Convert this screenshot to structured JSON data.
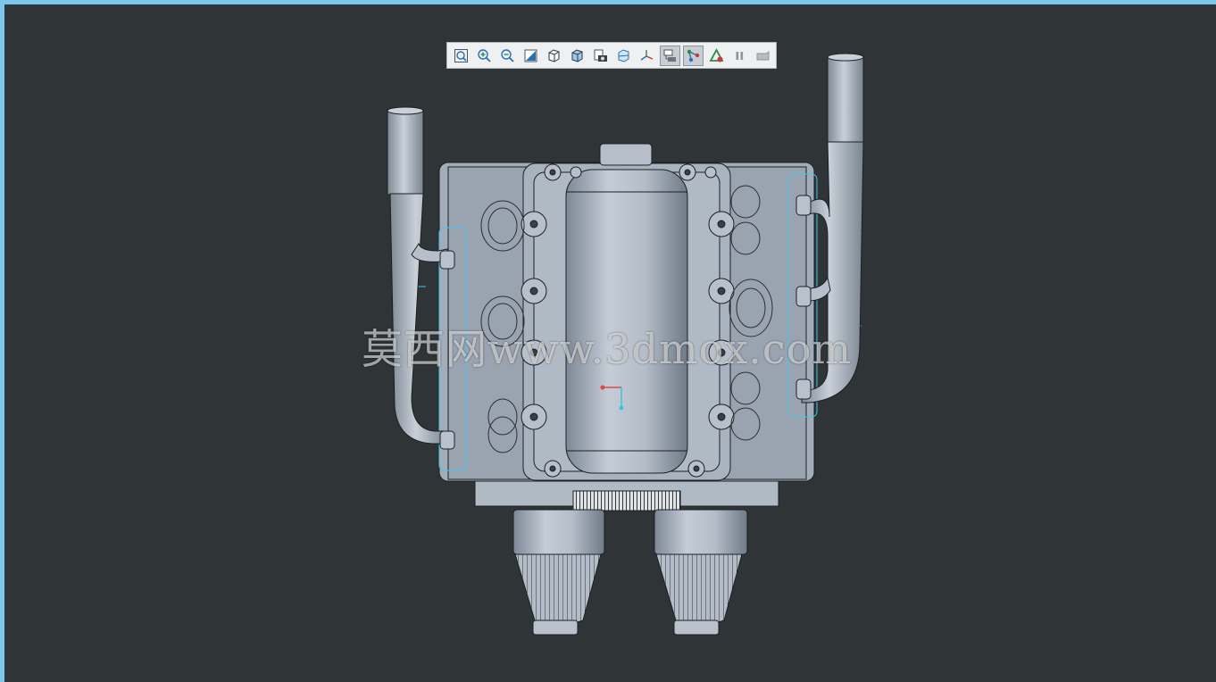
{
  "toolbar": {
    "buttons": [
      {
        "icon": "zoom-fit-icon",
        "active": false
      },
      {
        "icon": "zoom-in-icon",
        "active": false
      },
      {
        "icon": "zoom-out-icon",
        "active": false
      },
      {
        "icon": "zoom-window-icon",
        "active": false
      },
      {
        "icon": "view-cube-icon",
        "active": false
      },
      {
        "icon": "display-style-icon",
        "active": false
      },
      {
        "icon": "screenshot-icon",
        "active": false
      },
      {
        "icon": "section-view-icon",
        "active": false
      },
      {
        "icon": "axes-display-icon",
        "active": false
      },
      {
        "icon": "tree-view-icon",
        "active": true
      },
      {
        "icon": "connections-icon",
        "active": true
      },
      {
        "icon": "measure-icon",
        "active": false
      },
      {
        "icon": "pause-icon",
        "active": false
      },
      {
        "icon": "reset-icon",
        "active": false
      }
    ]
  },
  "watermark": {
    "text": "莫西网www.3dmox.com"
  },
  "colors": {
    "viewport_bg": "#2f3436",
    "frame": "#7fc6ee",
    "part_body": "#a7b1bd",
    "part_edge": "#1c2024",
    "highlight_edge": "#3fc8f0",
    "axis_x": "#e34646",
    "axis_y": "#39c6d8"
  }
}
